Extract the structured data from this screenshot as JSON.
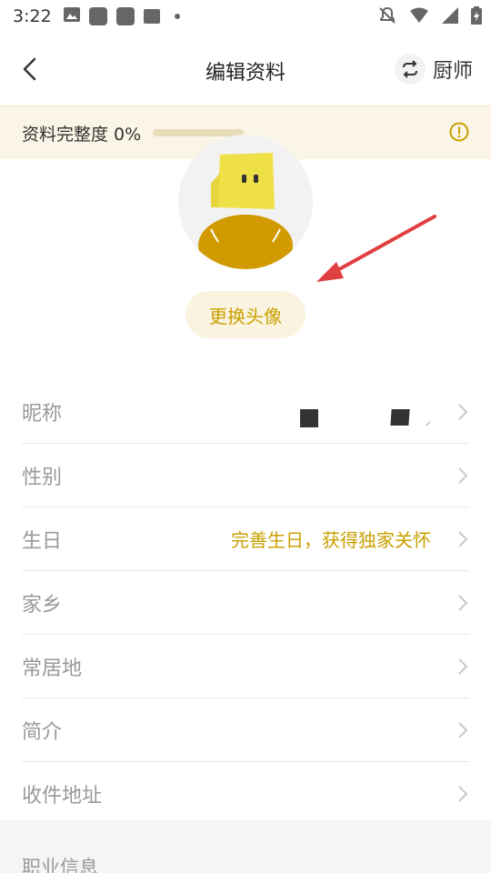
{
  "status_bar": {
    "time": "3:22",
    "icons_left": [
      "image-icon",
      "app-icon",
      "app-icon",
      "app-icon",
      "dot-icon"
    ],
    "icons_right": [
      "bell-off-icon",
      "wifi-icon",
      "signal-icon",
      "battery-icon"
    ]
  },
  "header": {
    "title": "编辑资料",
    "switch_label": "厨师"
  },
  "completeness": {
    "label": "资料完整度 0%",
    "progress": 0
  },
  "avatar": {
    "change_label": "更换头像"
  },
  "profile_items": [
    {
      "key": "nickname",
      "label": "昵称",
      "value": ""
    },
    {
      "key": "gender",
      "label": "性别",
      "value": ""
    },
    {
      "key": "birthday",
      "label": "生日",
      "value": "完善生日，获得独家关怀"
    },
    {
      "key": "hometown",
      "label": "家乡",
      "value": ""
    },
    {
      "key": "residence",
      "label": "常居地",
      "value": ""
    },
    {
      "key": "bio",
      "label": "简介",
      "value": ""
    },
    {
      "key": "address",
      "label": "收件地址",
      "value": ""
    }
  ],
  "sections": {
    "career": "职业信息"
  },
  "colors": {
    "accent": "#c9a000",
    "banner_bg": "#faf5e6",
    "arrow": "#e04040"
  }
}
